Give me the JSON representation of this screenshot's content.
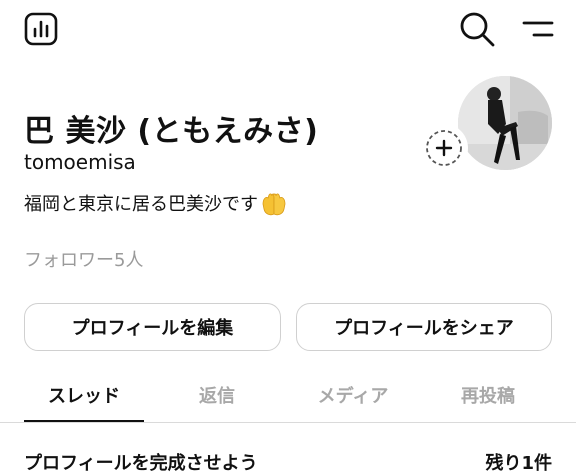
{
  "header": {
    "insights_icon": "bar-chart-icon",
    "search_icon": "search-icon",
    "menu_icon": "menu-icon"
  },
  "profile": {
    "name": "巴 美沙 (ともえみさ)",
    "handle": "tomoemisa",
    "bio": "福岡と東京に居る巴美沙です",
    "bio_emoji": "raised-hands-icon",
    "followers": "フォロワー5人",
    "add_icon": "plus-icon"
  },
  "actions": {
    "edit_label": "プロフィールを編集",
    "share_label": "プロフィールをシェア"
  },
  "tabs": [
    {
      "label": "スレッド",
      "active": true
    },
    {
      "label": "返信",
      "active": false
    },
    {
      "label": "メディア",
      "active": false
    },
    {
      "label": "再投稿",
      "active": false
    }
  ],
  "completion": {
    "title": "プロフィールを完成させよう",
    "remaining": "残り1件"
  },
  "colors": {
    "text": "#111111",
    "muted": "#9a9a9a",
    "border": "#d0d0d0",
    "emoji": "#f5c133"
  }
}
